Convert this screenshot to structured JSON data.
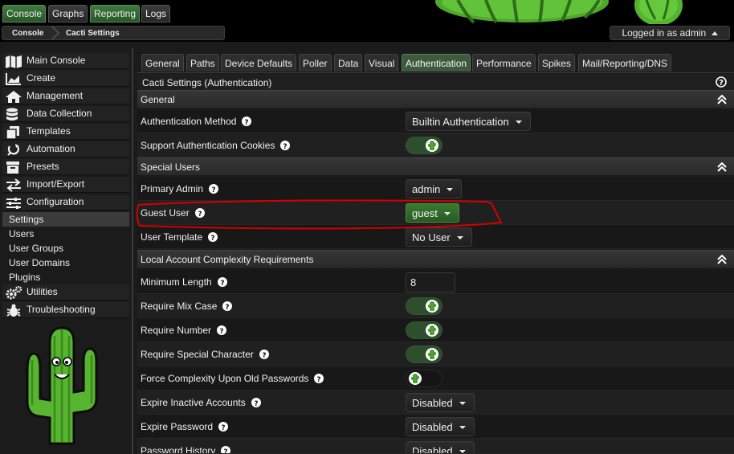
{
  "top_tabs": [
    {
      "label": "Console",
      "active": true
    },
    {
      "label": "Graphs",
      "active": false
    },
    {
      "label": "Reporting",
      "active": false
    },
    {
      "label": "Logs",
      "active": false
    }
  ],
  "breadcrumb": [
    "Console",
    "Cacti Settings"
  ],
  "user": {
    "logged_in_text": "Logged in as admin"
  },
  "sidebar": {
    "items": [
      {
        "label": "Main Console",
        "icon": "map-icon"
      },
      {
        "label": "Create",
        "icon": "chart-icon"
      },
      {
        "label": "Management",
        "icon": "home-icon"
      },
      {
        "label": "Data Collection",
        "icon": "database-icon"
      },
      {
        "label": "Templates",
        "icon": "copy-icon"
      },
      {
        "label": "Automation",
        "icon": "circle-arrow-icon"
      },
      {
        "label": "Presets",
        "icon": "archive-icon"
      },
      {
        "label": "Import/Export",
        "icon": "exchange-icon"
      },
      {
        "label": "Configuration",
        "icon": "sliders-icon"
      }
    ],
    "config_sub": [
      {
        "label": "Settings",
        "active": true
      },
      {
        "label": "Users",
        "active": false
      },
      {
        "label": "User Groups",
        "active": false
      },
      {
        "label": "User Domains",
        "active": false
      },
      {
        "label": "Plugins",
        "active": false
      }
    ],
    "after": [
      {
        "label": "Utilities",
        "icon": "cogs-icon"
      },
      {
        "label": "Troubleshooting",
        "icon": "bug-icon"
      }
    ]
  },
  "tabs": [
    "General",
    "Paths",
    "Device Defaults",
    "Poller",
    "Data",
    "Visual",
    "Authentication",
    "Performance",
    "Spikes",
    "Mail/Reporting/DNS"
  ],
  "selected_tab": "Authentication",
  "page_title": "Cacti Settings (Authentication)",
  "sections": {
    "general": "General",
    "special_users": "Special Users",
    "complexity": "Local Account Complexity Requirements"
  },
  "fields": {
    "auth_method": {
      "label": "Authentication Method",
      "value": "Builtin Authentication"
    },
    "auth_cookies": {
      "label": "Support Authentication Cookies",
      "checked": true
    },
    "primary_admin": {
      "label": "Primary Admin",
      "value": "admin"
    },
    "guest_user": {
      "label": "Guest User",
      "value": "guest"
    },
    "user_template": {
      "label": "User Template",
      "value": "No User"
    },
    "min_length": {
      "label": "Minimum Length",
      "value": "8"
    },
    "mix_case": {
      "label": "Require Mix Case",
      "checked": true
    },
    "require_number": {
      "label": "Require Number",
      "checked": true
    },
    "special_char": {
      "label": "Require Special Character",
      "checked": true
    },
    "force_complexity": {
      "label": "Force Complexity Upon Old Passwords",
      "checked": false
    },
    "expire_inactive": {
      "label": "Expire Inactive Accounts",
      "value": "Disabled"
    },
    "expire_password": {
      "label": "Expire Password",
      "value": "Disabled"
    },
    "password_history": {
      "label": "Password History",
      "value": "Disabled"
    }
  },
  "colors": {
    "accent_green": "#3a7a32",
    "annotation_red": "#d40000"
  }
}
